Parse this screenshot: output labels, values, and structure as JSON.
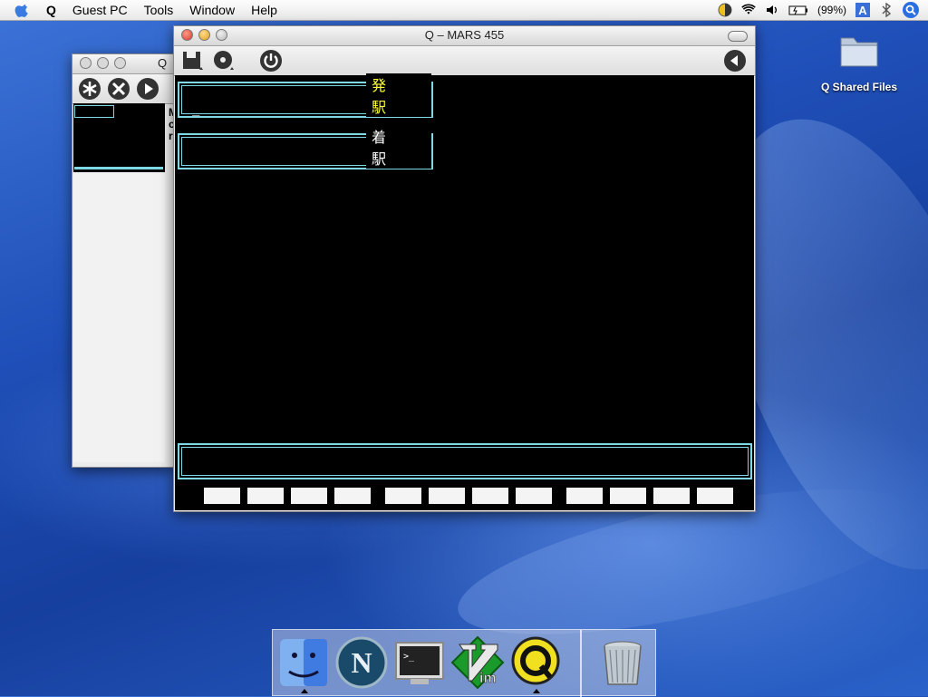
{
  "menubar": {
    "app_name": "Q",
    "items": [
      "Guest PC",
      "Tools",
      "Window",
      "Help"
    ],
    "battery": "(99%)"
  },
  "desktop": {
    "shared_files_label": "Q Shared Files"
  },
  "bg_window": {
    "title": "Q",
    "clipped_text": "M\nc\nr"
  },
  "main_window": {
    "title": "Q – MARS 455",
    "field_departure_label": "発 駅",
    "field_arrival_label": "着 駅",
    "cursor": "_",
    "departure_label_color": "#ffff33",
    "arrival_label_color": "#ffffff",
    "border_color": "#7fd8e6",
    "function_keys": 12
  },
  "dock": {
    "items": [
      "finder-icon",
      "netscape-icon",
      "terminal-icon",
      "vim-icon",
      "q-icon",
      "trash-icon"
    ]
  }
}
